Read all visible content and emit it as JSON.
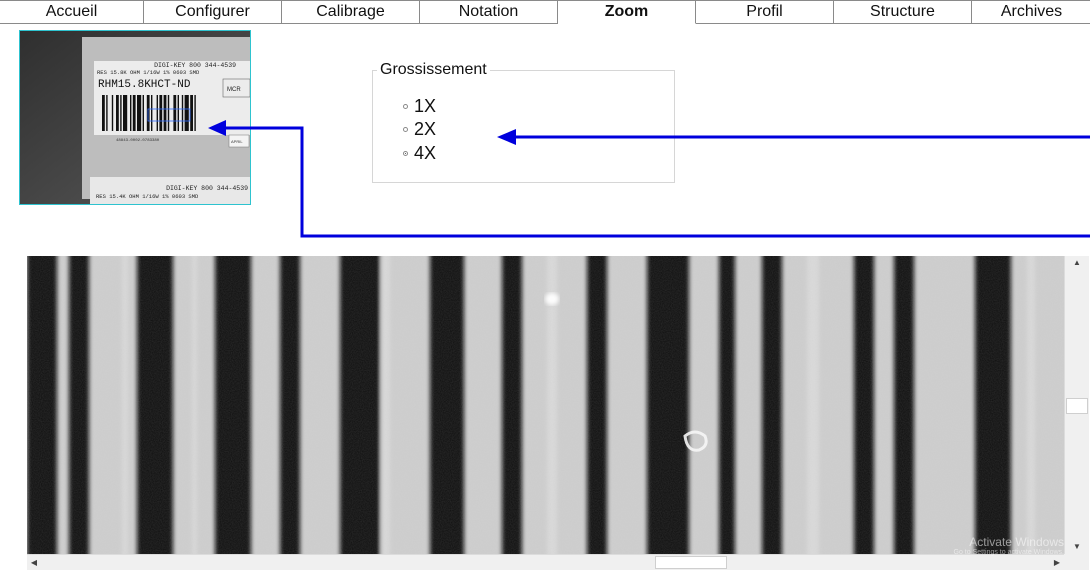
{
  "tabs": [
    {
      "label": "Accueil",
      "active": false
    },
    {
      "label": "Configurer",
      "active": false
    },
    {
      "label": "Calibrage",
      "active": false
    },
    {
      "label": "Notation",
      "active": false
    },
    {
      "label": "Zoom",
      "active": true
    },
    {
      "label": "Profil",
      "active": false
    },
    {
      "label": "Structure",
      "active": false
    },
    {
      "label": "Archives",
      "active": false
    }
  ],
  "thumbnail": {
    "label_line1": "DIGI-KEY 800 344-4539",
    "label_line2": "RES 15.8K OHM 1/16W 1% 0603 SMD",
    "part_number": "RHM15.8KHCT-ND",
    "side_text": "MCR",
    "barcode_number": "48843-0002-0783380",
    "small_box": "APRIL",
    "label2_line1": "DIGI-KEY 800 344-4539",
    "label2_line2": "RES 15.4K OHM 1/16W 1% 0603 SMD",
    "selection_color": "#2f6bff"
  },
  "zoom_group": {
    "title": "Grossissement",
    "options": [
      {
        "label": "1X",
        "selected": false
      },
      {
        "label": "2X",
        "selected": false
      },
      {
        "label": "4X",
        "selected": true
      }
    ]
  },
  "annotation": {
    "arrow_color": "#0000dd"
  },
  "watermark": {
    "title": "Activate Windows",
    "subtitle": "Go to Settings to activate Windows."
  },
  "scroll": {
    "up": "▲",
    "down": "▼",
    "left": "◀",
    "right": "▶"
  }
}
